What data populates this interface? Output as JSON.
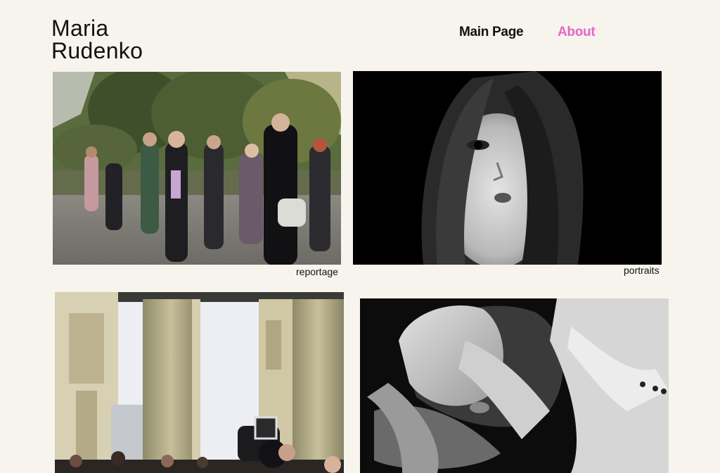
{
  "header": {
    "name_line1": "Maria",
    "name_line2": "Rudenko"
  },
  "nav": {
    "items": [
      {
        "label": "Main Page",
        "active": false
      },
      {
        "label": "About",
        "active": true
      }
    ],
    "active_color": "#e866c8"
  },
  "gallery": {
    "items": [
      {
        "caption": "reportage",
        "image": "street crowd group photo"
      },
      {
        "caption": "portraits",
        "image": "black and white portrait of woman"
      },
      {
        "caption": "",
        "image": "brandenburg gate columns with photographers"
      },
      {
        "caption": "",
        "image": "black and white portrait woman lying with head back"
      }
    ]
  },
  "colors": {
    "background": "#f7f4ee",
    "text": "#111111"
  }
}
